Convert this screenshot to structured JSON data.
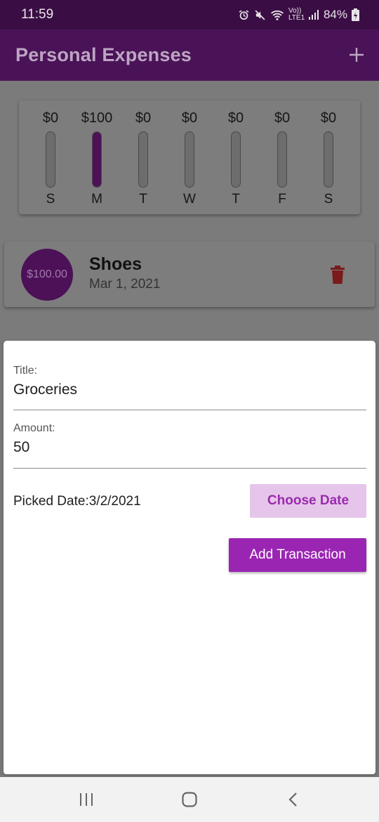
{
  "status_bar": {
    "time": "11:59",
    "network_label": "Vo)) LTE1",
    "battery": "84%",
    "icons": [
      "alarm-icon",
      "mute-icon",
      "wifi-icon",
      "signal-icon",
      "battery-icon"
    ]
  },
  "app_bar": {
    "title": "Personal Expenses",
    "add_icon": "plus-icon"
  },
  "chart_data": {
    "type": "bar",
    "categories": [
      "S",
      "M",
      "T",
      "W",
      "T",
      "F",
      "S"
    ],
    "value_labels": [
      "$0",
      "$100",
      "$0",
      "$0",
      "$0",
      "$0",
      "$0"
    ],
    "values": [
      0,
      100,
      0,
      0,
      0,
      0,
      0
    ],
    "bar_fill_fraction": [
      0,
      1,
      0,
      0,
      0,
      0,
      0
    ]
  },
  "transactions": [
    {
      "amount": "$100.00",
      "title": "Shoes",
      "date": "Mar 1, 2021",
      "delete_icon": "trash-icon"
    }
  ],
  "new_transaction": {
    "title_label": "Title:",
    "title_value": "Groceries",
    "amount_label": "Amount:",
    "amount_value": "50",
    "picked_date": "Picked Date:3/2/2021",
    "choose_date_label": "Choose Date",
    "add_transaction_label": "Add Transaction"
  },
  "nav_bar": {
    "icons": [
      "recent-apps-icon",
      "home-icon",
      "back-icon"
    ]
  },
  "colors": {
    "primary": "#9b25b3",
    "app_bar_dimmed": "#4a1357",
    "accent_light": "#e5c6ea",
    "delete": "#c62828"
  }
}
